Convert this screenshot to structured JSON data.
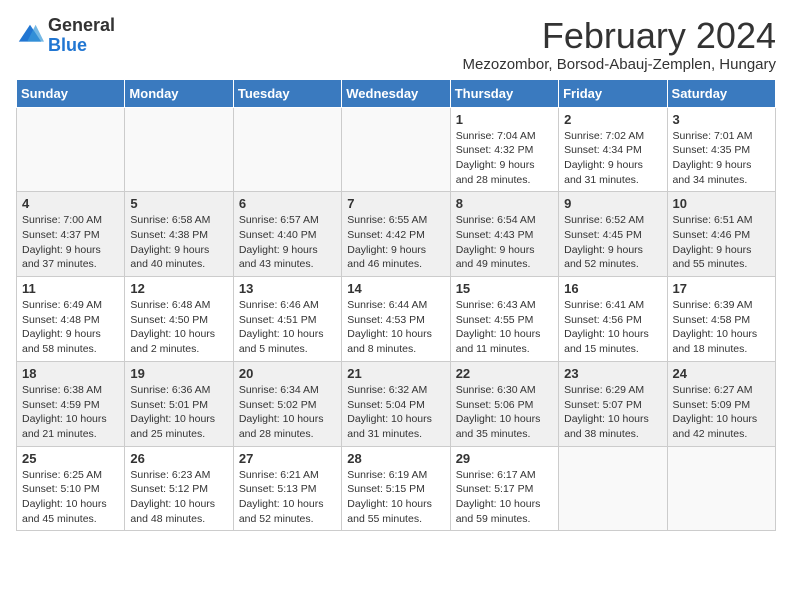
{
  "header": {
    "logo_general": "General",
    "logo_blue": "Blue",
    "main_title": "February 2024",
    "subtitle": "Mezozombor, Borsod-Abauj-Zemplen, Hungary"
  },
  "days_of_week": [
    "Sunday",
    "Monday",
    "Tuesday",
    "Wednesday",
    "Thursday",
    "Friday",
    "Saturday"
  ],
  "weeks": [
    [
      {
        "day": "",
        "info": ""
      },
      {
        "day": "",
        "info": ""
      },
      {
        "day": "",
        "info": ""
      },
      {
        "day": "",
        "info": ""
      },
      {
        "day": "1",
        "info": "Sunrise: 7:04 AM\nSunset: 4:32 PM\nDaylight: 9 hours and 28 minutes."
      },
      {
        "day": "2",
        "info": "Sunrise: 7:02 AM\nSunset: 4:34 PM\nDaylight: 9 hours and 31 minutes."
      },
      {
        "day": "3",
        "info": "Sunrise: 7:01 AM\nSunset: 4:35 PM\nDaylight: 9 hours and 34 minutes."
      }
    ],
    [
      {
        "day": "4",
        "info": "Sunrise: 7:00 AM\nSunset: 4:37 PM\nDaylight: 9 hours and 37 minutes."
      },
      {
        "day": "5",
        "info": "Sunrise: 6:58 AM\nSunset: 4:38 PM\nDaylight: 9 hours and 40 minutes."
      },
      {
        "day": "6",
        "info": "Sunrise: 6:57 AM\nSunset: 4:40 PM\nDaylight: 9 hours and 43 minutes."
      },
      {
        "day": "7",
        "info": "Sunrise: 6:55 AM\nSunset: 4:42 PM\nDaylight: 9 hours and 46 minutes."
      },
      {
        "day": "8",
        "info": "Sunrise: 6:54 AM\nSunset: 4:43 PM\nDaylight: 9 hours and 49 minutes."
      },
      {
        "day": "9",
        "info": "Sunrise: 6:52 AM\nSunset: 4:45 PM\nDaylight: 9 hours and 52 minutes."
      },
      {
        "day": "10",
        "info": "Sunrise: 6:51 AM\nSunset: 4:46 PM\nDaylight: 9 hours and 55 minutes."
      }
    ],
    [
      {
        "day": "11",
        "info": "Sunrise: 6:49 AM\nSunset: 4:48 PM\nDaylight: 9 hours and 58 minutes."
      },
      {
        "day": "12",
        "info": "Sunrise: 6:48 AM\nSunset: 4:50 PM\nDaylight: 10 hours and 2 minutes."
      },
      {
        "day": "13",
        "info": "Sunrise: 6:46 AM\nSunset: 4:51 PM\nDaylight: 10 hours and 5 minutes."
      },
      {
        "day": "14",
        "info": "Sunrise: 6:44 AM\nSunset: 4:53 PM\nDaylight: 10 hours and 8 minutes."
      },
      {
        "day": "15",
        "info": "Sunrise: 6:43 AM\nSunset: 4:55 PM\nDaylight: 10 hours and 11 minutes."
      },
      {
        "day": "16",
        "info": "Sunrise: 6:41 AM\nSunset: 4:56 PM\nDaylight: 10 hours and 15 minutes."
      },
      {
        "day": "17",
        "info": "Sunrise: 6:39 AM\nSunset: 4:58 PM\nDaylight: 10 hours and 18 minutes."
      }
    ],
    [
      {
        "day": "18",
        "info": "Sunrise: 6:38 AM\nSunset: 4:59 PM\nDaylight: 10 hours and 21 minutes."
      },
      {
        "day": "19",
        "info": "Sunrise: 6:36 AM\nSunset: 5:01 PM\nDaylight: 10 hours and 25 minutes."
      },
      {
        "day": "20",
        "info": "Sunrise: 6:34 AM\nSunset: 5:02 PM\nDaylight: 10 hours and 28 minutes."
      },
      {
        "day": "21",
        "info": "Sunrise: 6:32 AM\nSunset: 5:04 PM\nDaylight: 10 hours and 31 minutes."
      },
      {
        "day": "22",
        "info": "Sunrise: 6:30 AM\nSunset: 5:06 PM\nDaylight: 10 hours and 35 minutes."
      },
      {
        "day": "23",
        "info": "Sunrise: 6:29 AM\nSunset: 5:07 PM\nDaylight: 10 hours and 38 minutes."
      },
      {
        "day": "24",
        "info": "Sunrise: 6:27 AM\nSunset: 5:09 PM\nDaylight: 10 hours and 42 minutes."
      }
    ],
    [
      {
        "day": "25",
        "info": "Sunrise: 6:25 AM\nSunset: 5:10 PM\nDaylight: 10 hours and 45 minutes."
      },
      {
        "day": "26",
        "info": "Sunrise: 6:23 AM\nSunset: 5:12 PM\nDaylight: 10 hours and 48 minutes."
      },
      {
        "day": "27",
        "info": "Sunrise: 6:21 AM\nSunset: 5:13 PM\nDaylight: 10 hours and 52 minutes."
      },
      {
        "day": "28",
        "info": "Sunrise: 6:19 AM\nSunset: 5:15 PM\nDaylight: 10 hours and 55 minutes."
      },
      {
        "day": "29",
        "info": "Sunrise: 6:17 AM\nSunset: 5:17 PM\nDaylight: 10 hours and 59 minutes."
      },
      {
        "day": "",
        "info": ""
      },
      {
        "day": "",
        "info": ""
      }
    ]
  ]
}
